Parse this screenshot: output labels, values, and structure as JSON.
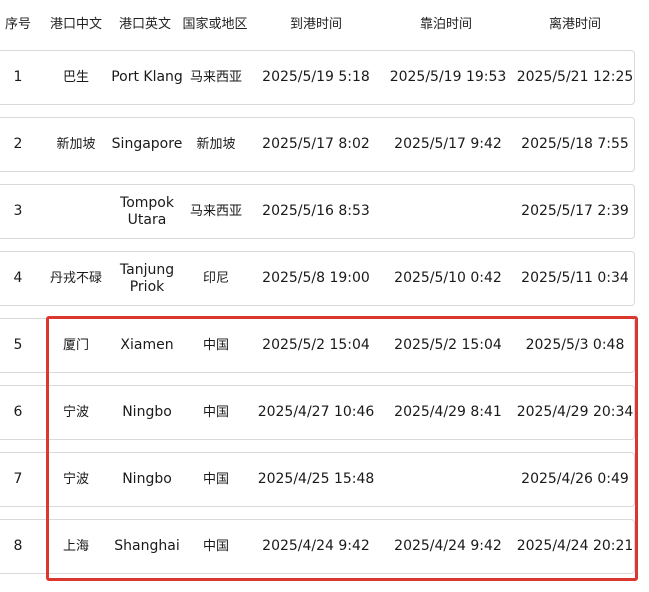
{
  "headers": [
    "序号",
    "港口中文",
    "港口英文",
    "国家或地区",
    "到港时间",
    "靠泊时间",
    "离港时间"
  ],
  "rows": [
    {
      "no": "1",
      "port_cn": "巴生",
      "port_en": "Port Klang",
      "country": "马来西亚",
      "arrival": "2025/5/19 5:18",
      "berthing": "2025/5/19 19:53",
      "departure": "2025/5/21 12:25"
    },
    {
      "no": "2",
      "port_cn": "新加坡",
      "port_en": "Singapore",
      "country": "新加坡",
      "arrival": "2025/5/17 8:02",
      "berthing": "2025/5/17 9:42",
      "departure": "2025/5/18 7:55"
    },
    {
      "no": "3",
      "port_cn": "",
      "port_en": "Tompok Utara",
      "country": "马来西亚",
      "arrival": "2025/5/16 8:53",
      "berthing": "",
      "departure": "2025/5/17 2:39"
    },
    {
      "no": "4",
      "port_cn": "丹戎不碌",
      "port_en": "Tanjung Priok",
      "country": "印尼",
      "arrival": "2025/5/8 19:00",
      "berthing": "2025/5/10 0:42",
      "departure": "2025/5/11 0:34"
    },
    {
      "no": "5",
      "port_cn": "厦门",
      "port_en": "Xiamen",
      "country": "中国",
      "arrival": "2025/5/2 15:04",
      "berthing": "2025/5/2 15:04",
      "departure": "2025/5/3 0:48"
    },
    {
      "no": "6",
      "port_cn": "宁波",
      "port_en": "Ningbo",
      "country": "中国",
      "arrival": "2025/4/27 10:46",
      "berthing": "2025/4/29 8:41",
      "departure": "2025/4/29 20:34"
    },
    {
      "no": "7",
      "port_cn": "宁波",
      "port_en": "Ningbo",
      "country": "中国",
      "arrival": "2025/4/25 15:48",
      "berthing": "",
      "departure": "2025/4/26 0:49"
    },
    {
      "no": "8",
      "port_cn": "上海",
      "port_en": "Shanghai",
      "country": "中国",
      "arrival": "2025/4/24 9:42",
      "berthing": "2025/4/24 9:42",
      "departure": "2025/4/24 20:21"
    }
  ],
  "highlight_color": "#d9372f"
}
